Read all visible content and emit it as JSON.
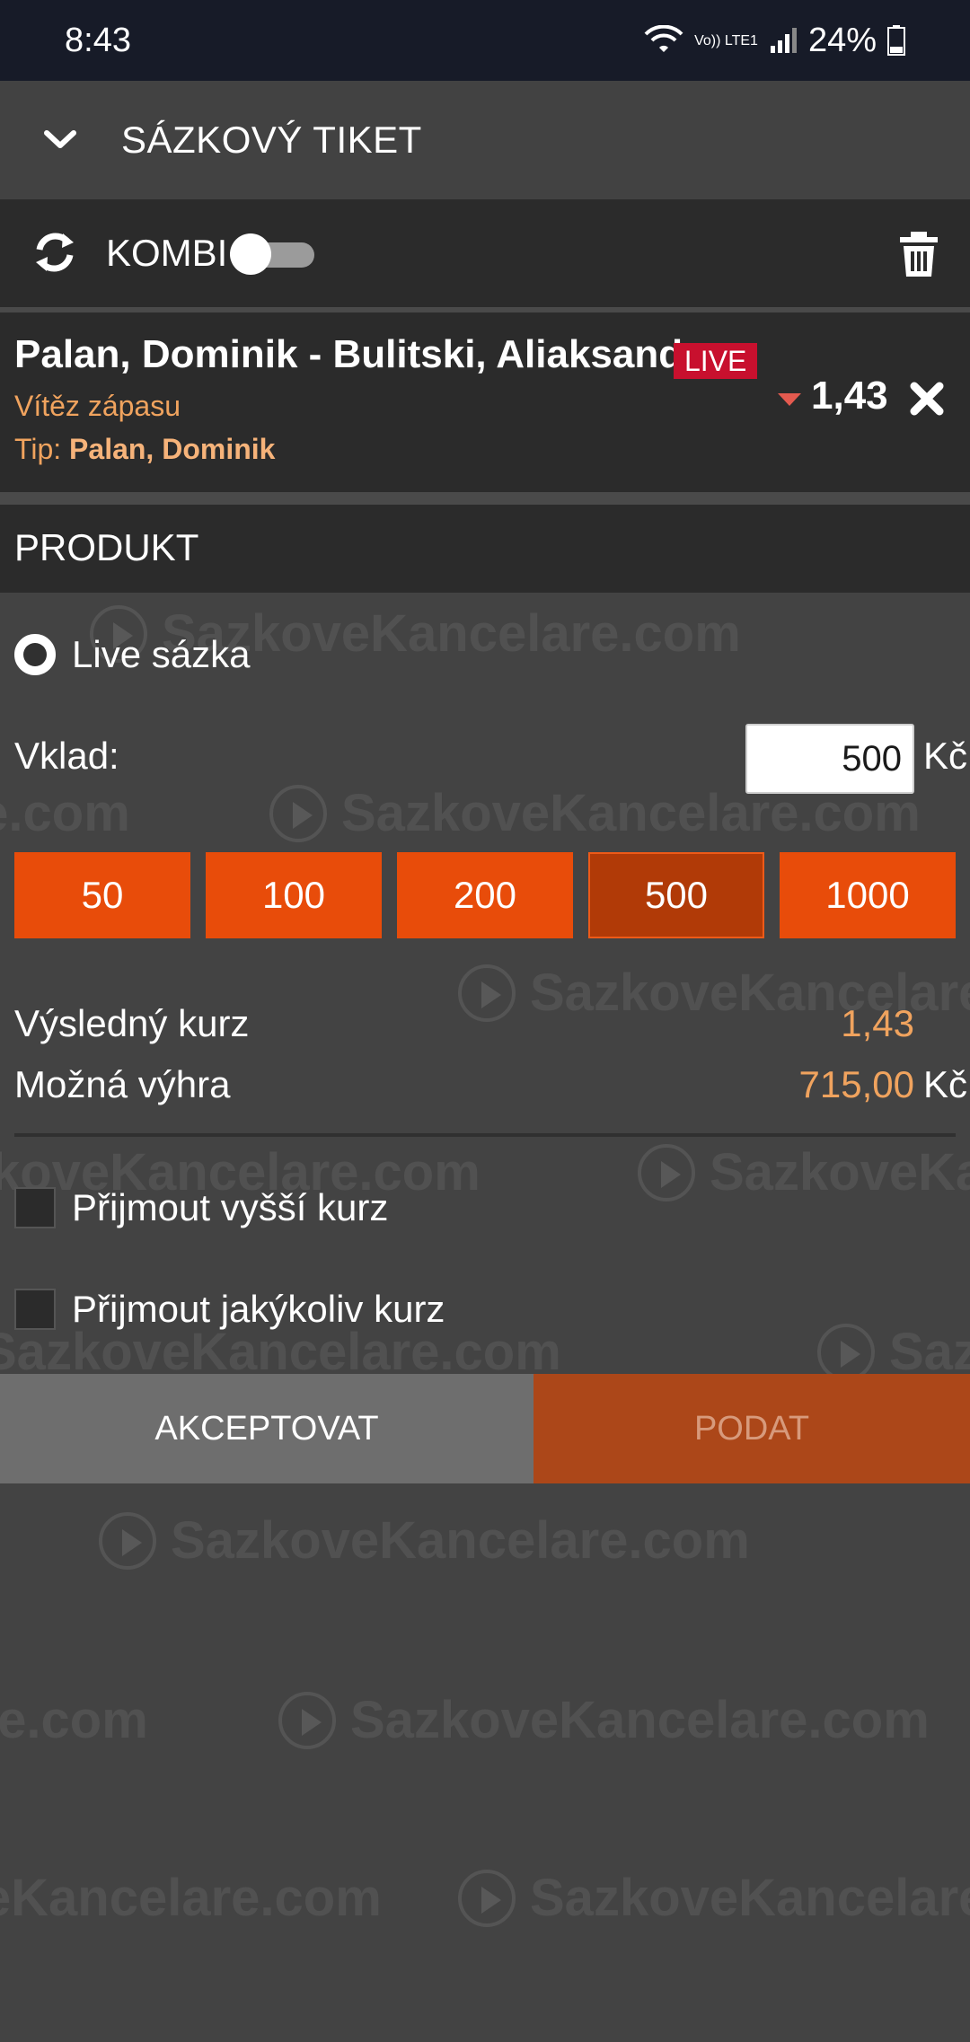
{
  "status_bar": {
    "time": "8:43",
    "volte_label": "Vo)) LTE1",
    "battery_percent": "24%"
  },
  "header": {
    "title": "SÁZKOVÝ TIKET",
    "icon": "chevron-down-icon"
  },
  "ticket_bar": {
    "kombi_label": "KOMBI",
    "kombi_toggle_on": false
  },
  "event": {
    "name": "Palan, Dominik - Bulitski, Aliaksandr",
    "live_badge": "LIVE",
    "market": "Vítěz zápasu",
    "tip_label": "Tip:",
    "tip_value": "Palan, Dominik",
    "odds": "1,43",
    "odds_trend": "down"
  },
  "product": {
    "section_title": "PRODUKT",
    "option_label": "Live sázka"
  },
  "stake": {
    "label": "Vklad:",
    "value": "500",
    "currency": "Kč",
    "quick_amounts": [
      "50",
      "100",
      "200",
      "500",
      "1000"
    ],
    "selected_amount": "500"
  },
  "summary": {
    "total_odds_label": "Výsledný kurz",
    "total_odds_value": "1,43",
    "possible_win_label": "Možná výhra",
    "possible_win_value": "715,00",
    "currency": "Kč"
  },
  "options": {
    "accept_higher_label": "Přijmout vyšší kurz",
    "accept_any_label": "Přijmout jakýkoliv kurz"
  },
  "actions": {
    "accept_label": "AKCEPTOVAT",
    "submit_label": "PODAT"
  },
  "watermark": {
    "text": "SazkoveKancelare.com"
  },
  "colors": {
    "accent": "#e84c0a",
    "accent_selected": "#b13a07",
    "odds_text": "#f0a35e",
    "live_red": "#c8102e",
    "panel_dark": "#2b2b2b",
    "background": "#434343"
  }
}
